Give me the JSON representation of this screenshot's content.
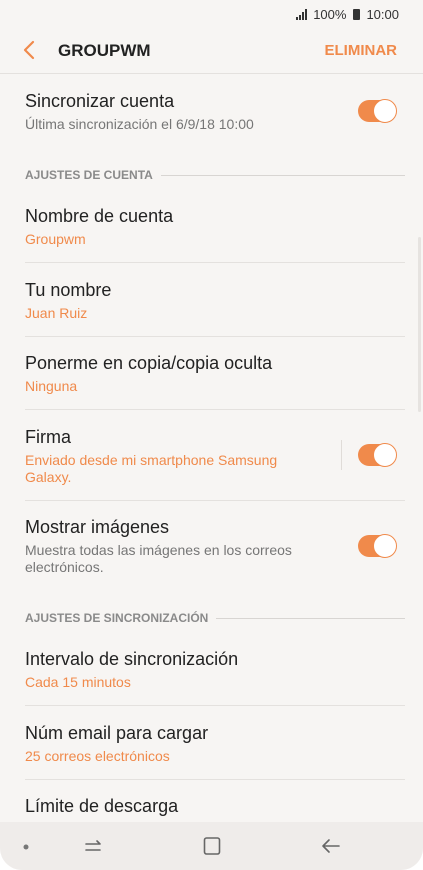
{
  "status_bar": {
    "battery": "100%",
    "time": "10:00"
  },
  "header": {
    "back_icon": "arrow-left-icon",
    "title": "GROUPWM",
    "action": "ELIMINAR"
  },
  "colors": {
    "accent": "#f08a4b",
    "background": "#f7f5f3",
    "navbar": "#efecea"
  },
  "rows": {
    "sync": {
      "title": "Sincronizar cuenta",
      "subtitle": "Última sincronización el 6/9/18  10:00",
      "toggle_on": true
    },
    "account_name": {
      "title": "Nombre de cuenta",
      "value": "Groupwm"
    },
    "your_name": {
      "title": "Tu nombre",
      "value": "Juan Ruiz"
    },
    "cc_bcc": {
      "title": "Ponerme en copia/copia oculta",
      "value": "Ninguna"
    },
    "signature": {
      "title": "Firma",
      "value_line1": "Enviado desde mi smartphone Samsung",
      "value_line2": "Galaxy.",
      "toggle_on": true
    },
    "show_images": {
      "title": "Mostrar imágenes",
      "subtitle_line1": "Muestra todas las imágenes en los correos",
      "subtitle_line2": "electrónicos.",
      "toggle_on": true
    },
    "sync_interval": {
      "title": "Intervalo de sincronización",
      "value": "Cada 15 minutos"
    },
    "emails_to_load": {
      "title": "Núm email para cargar",
      "value": "25 correos electrónicos"
    },
    "download_limit": {
      "title": "Límite de descarga"
    }
  },
  "sections": {
    "account_settings": "AJUSTES DE CUENTA",
    "sync_settings": "AJUSTES DE SINCRONIZACIÓN"
  },
  "navbar": {
    "items": [
      "dot-icon",
      "recent-apps-icon",
      "home-icon",
      "back-icon"
    ]
  }
}
